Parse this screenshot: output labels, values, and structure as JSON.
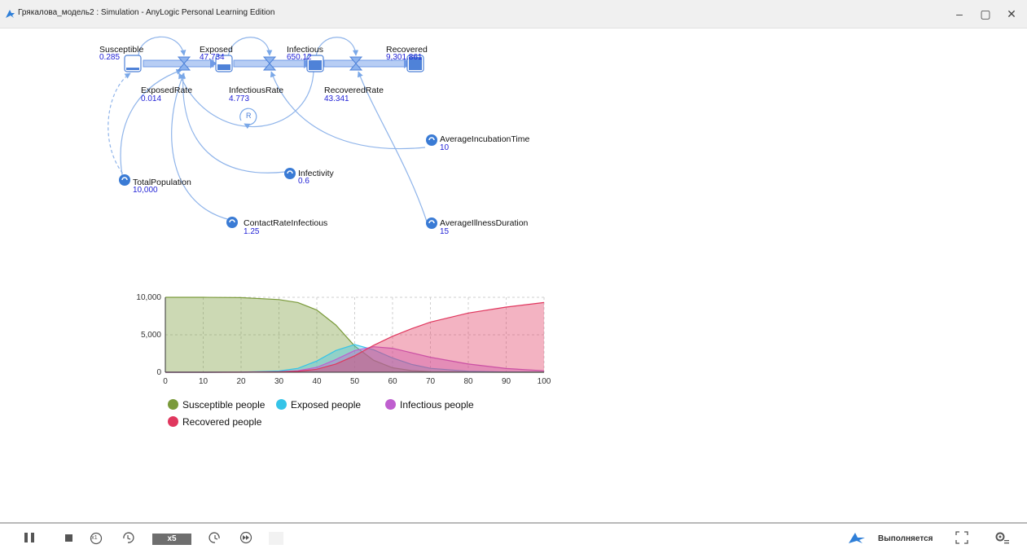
{
  "window": {
    "title": "Грякалова_модель2 : Simulation - AnyLogic Personal Learning Edition",
    "minimize_glyph": "–",
    "maximize_glyph": "▢",
    "close_glyph": "✕"
  },
  "stocks": [
    {
      "name": "Susceptible",
      "value": "0.285"
    },
    {
      "name": "Exposed",
      "value": "47.734"
    },
    {
      "name": "Infectious",
      "value": "650.12"
    },
    {
      "name": "Recovered",
      "value": "9,301.861"
    }
  ],
  "flows": [
    {
      "name": "ExposedRate",
      "value": "0.014"
    },
    {
      "name": "InfectiousRate",
      "value": "4.773"
    },
    {
      "name": "RecoveredRate",
      "value": "43.341"
    }
  ],
  "parameters": [
    {
      "name": "TotalPopulation",
      "value": "10,000"
    },
    {
      "name": "Infectivity",
      "value": "0.6"
    },
    {
      "name": "ContactRateInfectious",
      "value": "1.25"
    },
    {
      "name": "AverageIncubationTime",
      "value": "10"
    },
    {
      "name": "AverageIllnessDuration",
      "value": "15"
    }
  ],
  "loop_label": "R",
  "chart_data": {
    "type": "area",
    "x": [
      0,
      10,
      20,
      30,
      35,
      40,
      45,
      50,
      55,
      60,
      65,
      70,
      80,
      90,
      100
    ],
    "xlim": [
      0,
      100
    ],
    "ylim": [
      0,
      10000
    ],
    "xticks": [
      "0",
      "10",
      "20",
      "30",
      "40",
      "50",
      "60",
      "70",
      "80",
      "90",
      "100"
    ],
    "yticks": [
      "0",
      "5,000",
      "10,000"
    ],
    "grid": true,
    "legend_position": "bottom",
    "series": [
      {
        "name": "Susceptible people",
        "color": "#7a9a3a",
        "values": [
          10000,
          9995,
          9960,
          9700,
          9300,
          8300,
          6300,
          3500,
          1600,
          600,
          220,
          80,
          10,
          2,
          0.3
        ]
      },
      {
        "name": "Exposed people",
        "color": "#35c4e8",
        "values": [
          0,
          2,
          20,
          160,
          520,
          1500,
          2900,
          3700,
          3000,
          1900,
          1050,
          520,
          130,
          30,
          6
        ]
      },
      {
        "name": "Infectious people",
        "color": "#bf5fcf",
        "values": [
          0,
          1,
          10,
          70,
          210,
          650,
          1700,
          2900,
          3400,
          3200,
          2600,
          2000,
          1100,
          500,
          200
        ]
      },
      {
        "name": "Recovered people",
        "color": "#e0375e",
        "values": [
          0,
          1,
          5,
          40,
          120,
          400,
          1100,
          2200,
          3600,
          4800,
          5800,
          6700,
          7900,
          8700,
          9300
        ]
      }
    ]
  },
  "controls": {
    "x1_label": "x1",
    "speed_label": "x5",
    "status": "Выполняется"
  }
}
